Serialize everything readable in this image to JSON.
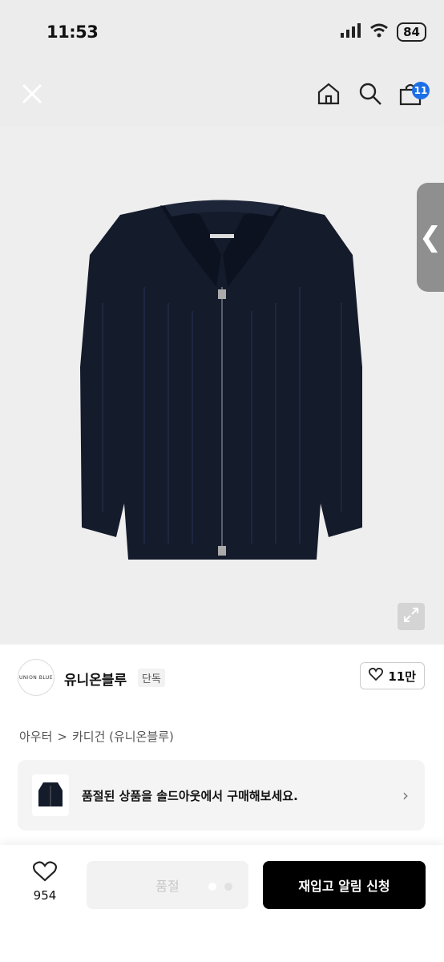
{
  "status_bar": {
    "time": "11:53",
    "battery": "84"
  },
  "header": {
    "cart_count": "11"
  },
  "product": {
    "brand_name": "유니온블루",
    "brand_logo_text": "UNION BLUE",
    "brand_tag": "단독",
    "like_count": "11만",
    "breadcrumb": {
      "category": "아우터",
      "separator": ">",
      "subcategory": "카디건 (유니온블루)"
    }
  },
  "soldout_banner": {
    "text": "품절된 상품을 솔드아웃에서 구매해보세요."
  },
  "bottom_bar": {
    "wish_count": "954",
    "soldout_label": "품절",
    "restock_label": "재입고 알림 신청"
  },
  "colors": {
    "accent_badge": "#1b6fe6",
    "primary_button": "#000000"
  }
}
